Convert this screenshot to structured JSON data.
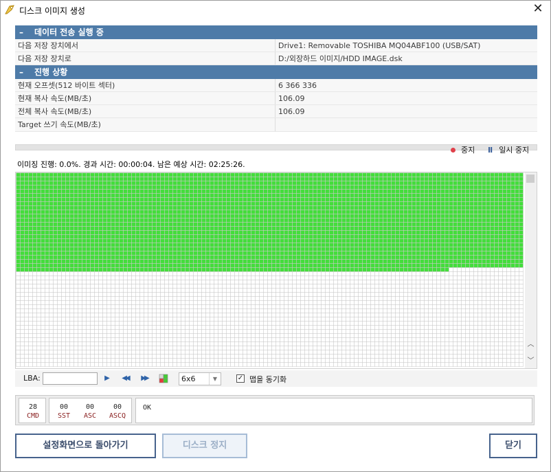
{
  "window": {
    "title": "디스크 이미지 생성",
    "close_glyph": "✕"
  },
  "transfer": {
    "header": "데이터 전송 실행 중",
    "header_prefix": "–",
    "rows": [
      {
        "label": "다음 저장 장치에서",
        "value": "Drive1: Removable TOSHIBA MQ04ABF100 (USB/SAT)"
      },
      {
        "label": "다음 저장 장치로",
        "value": "D:/외장하드 이미지/HDD IMAGE.dsk"
      }
    ]
  },
  "progress": {
    "header": "진행 상황",
    "header_prefix": "–",
    "rows": [
      {
        "label": "현재 오프셋(512 바이트 섹터)",
        "value": "6 366 336"
      },
      {
        "label": "현재 복사 속도(MB/초)",
        "value": "106.09"
      },
      {
        "label": "전체 복사 속도(MB/초)",
        "value": "106.09"
      },
      {
        "label": "Target 쓰기 속도(MB/초)",
        "value": ""
      }
    ]
  },
  "controls": {
    "stop_label": "중지",
    "pause_label": "일시 중지",
    "pause_glyph": "II",
    "progress_fraction": 0.0
  },
  "status_line": "이미징 진행: 0.0%. 경과 시간: 00:00:04. 남은 예상 시간: 02:25:26.",
  "map": {
    "done_color": "#44dd3c",
    "pending_color": "#ffffff",
    "grid_line_color": "#c9c9c9",
    "done_full_rows": 23,
    "done_partial_cells": 105
  },
  "lba_toolbar": {
    "label": "LBA:",
    "input_value": "",
    "play_icon": "▶",
    "rewind_icon": "◀◀",
    "forward_icon": "▶▶",
    "zoom_value": "6x6",
    "sync_checked": true,
    "sync_label": "맵을 동기화",
    "check_glyph": "✓"
  },
  "scsi": {
    "cmd_value": "28",
    "cmd_tag": "CMD",
    "sst_value": "00",
    "sst_tag": "SST",
    "asc_value": "00",
    "asc_tag": "ASC",
    "ascq_value": "00",
    "ascq_tag": "ASCQ",
    "message": "OK"
  },
  "buttons": {
    "back": "설정화면으로 돌아가기",
    "stop_disk": "디스크 정지",
    "close": "닫기"
  }
}
